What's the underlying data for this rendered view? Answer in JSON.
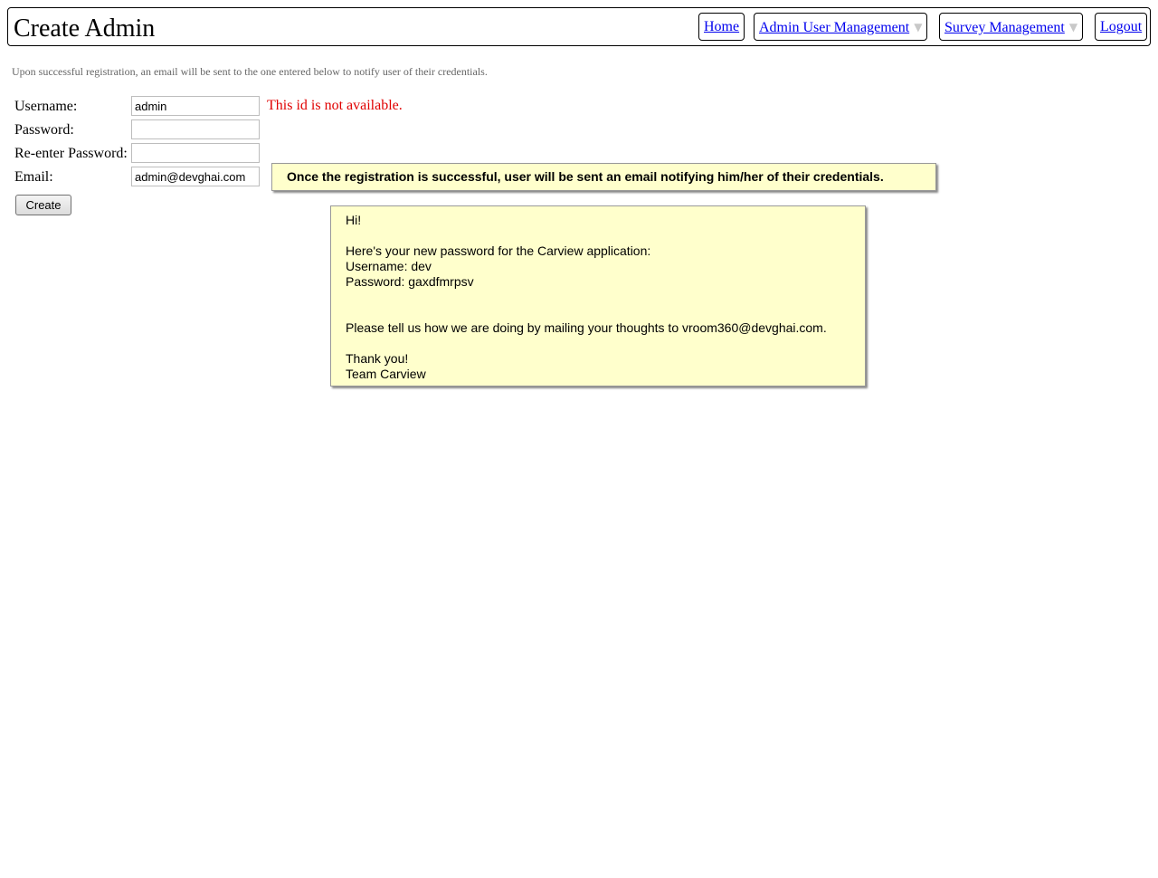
{
  "header": {
    "title": "Create Admin",
    "nav": {
      "home": "Home",
      "admin_user_management": "Admin User Management",
      "survey_management": "Survey Management",
      "logout": "Logout"
    },
    "caret_icon": "triangle-down"
  },
  "intro": "Upon successful registration, an email will be sent to the one entered below to notify user of their credentials.",
  "form": {
    "username_label": "Username:",
    "username_value": "admin",
    "username_error": "This id is not available.",
    "password_label": "Password:",
    "password_value": "",
    "reenter_label": "Re-enter Password:",
    "reenter_value": "",
    "email_label": "Email:",
    "email_value": "admin@devghai.com",
    "create_label": "Create"
  },
  "notes": {
    "registration": "Once the registration is successful, user will be sent an email notifying him/her of their credentials.",
    "email_preview": {
      "greeting": "Hi!",
      "intro_line": "Here's your new password for the Carview application:",
      "username_line": "Username: dev",
      "password_line": "Password: gaxdfmrpsv",
      "feedback_line": "Please tell us how we are doing by mailing your thoughts to vroom360@devghai.com.",
      "thanks": "Thank you!",
      "signature": "Team Carview"
    }
  },
  "colors": {
    "error": "#e00000",
    "note_background": "#ffffcc",
    "link": "#0000ee"
  }
}
